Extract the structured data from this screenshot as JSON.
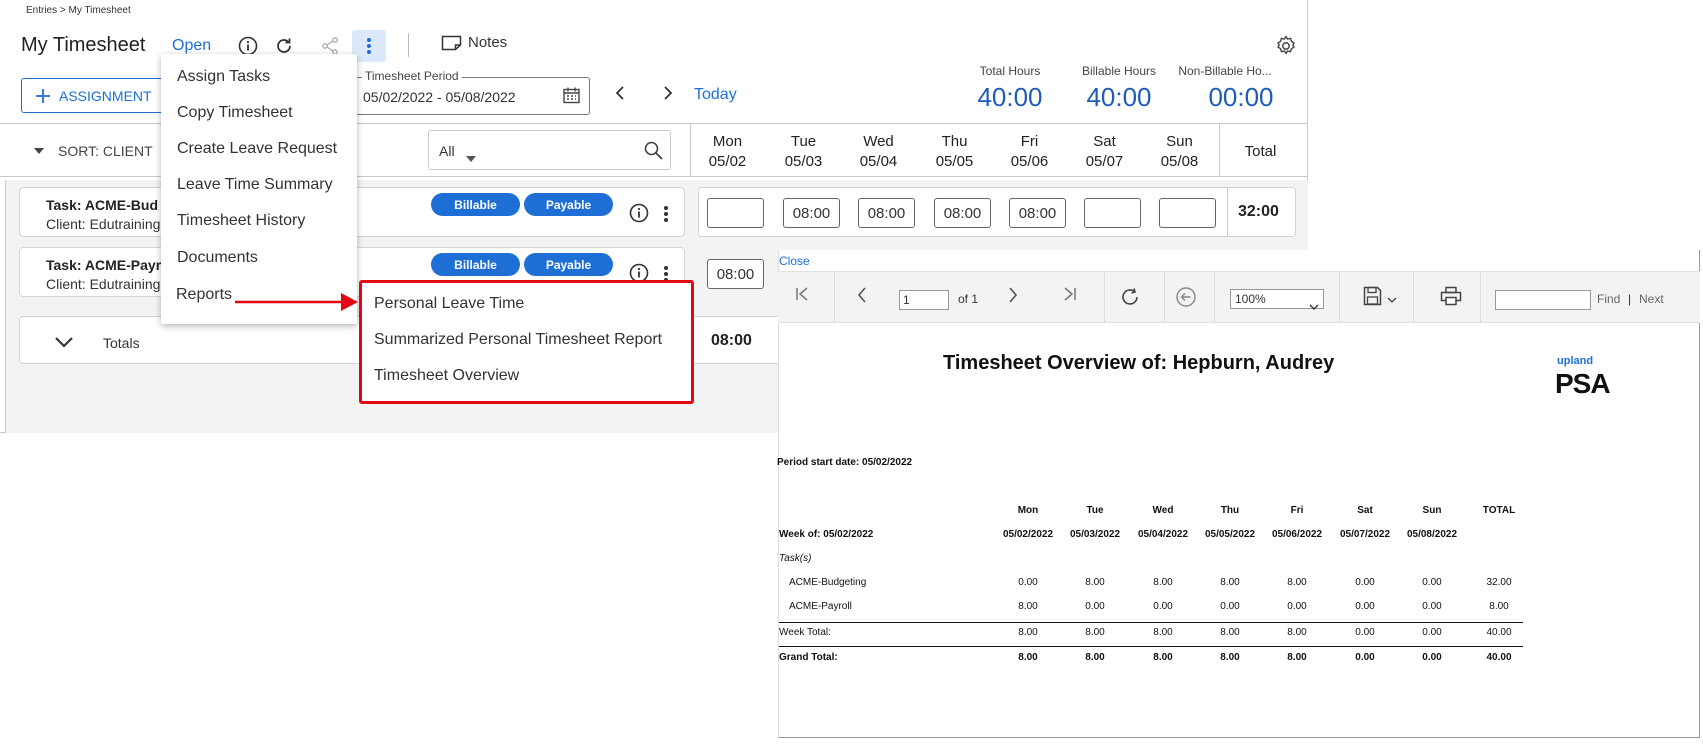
{
  "breadcrumb": "Entries > My Timesheet",
  "page_title": "My Timesheet",
  "status": "Open",
  "toolbar": {
    "notes_label": "Notes"
  },
  "assignment_button": "ASSIGNMENT",
  "period": {
    "label": "Timesheet Period",
    "value": "05/02/2022 - 05/08/2022",
    "today": "Today"
  },
  "summary": {
    "total_label": "Total Hours",
    "total_value": "40:00",
    "billable_label": "Billable Hours",
    "billable_value": "40:00",
    "nonbillable_label": "Non-Billable Ho...",
    "nonbillable_value": "00:00"
  },
  "sort_label": "SORT: CLIENT",
  "filter_value": "All",
  "days": [
    {
      "name": "Mon",
      "date": "05/02"
    },
    {
      "name": "Tue",
      "date": "05/03"
    },
    {
      "name": "Wed",
      "date": "05/04"
    },
    {
      "name": "Thu",
      "date": "05/05"
    },
    {
      "name": "Fri",
      "date": "05/06"
    },
    {
      "name": "Sat",
      "date": "05/07"
    },
    {
      "name": "Sun",
      "date": "05/08"
    }
  ],
  "total_header": "Total",
  "rows": [
    {
      "task": "Task: ACME-Bud",
      "client": "Client: Edutraining",
      "badges": [
        "Billable",
        "Payable"
      ],
      "hours": [
        "",
        "08:00",
        "08:00",
        "08:00",
        "08:00",
        "",
        ""
      ],
      "total": "32:00"
    },
    {
      "task": "Task: ACME-Payr",
      "client": "Client: Edutraining",
      "badges": [
        "Billable",
        "Payable"
      ],
      "hours": [
        "08:00"
      ]
    }
  ],
  "totals": {
    "label": "Totals",
    "mon": "08:00"
  },
  "menu": {
    "items": [
      "Assign Tasks",
      "Copy Timesheet",
      "Create Leave Request",
      "Leave Time Summary",
      "Timesheet History",
      "Documents",
      "Reports"
    ],
    "reports_submenu": [
      "Personal Leave Time",
      "Summarized Personal Timesheet Report",
      "Timesheet Overview"
    ]
  },
  "viewer": {
    "close": "Close",
    "page": "1",
    "of": "of 1",
    "zoom": "100%",
    "find": "Find",
    "next": "Next"
  },
  "report": {
    "title": "Timesheet Overview of:  Hepburn, Audrey",
    "logo_small": "upland",
    "logo_big": "PSA",
    "period_start": "Period start date: 05/02/2022",
    "day_headers": [
      "Mon",
      "Tue",
      "Wed",
      "Thu",
      "Fri",
      "Sat",
      "Sun",
      "TOTAL"
    ],
    "week_label": "Week of: 05/02/2022",
    "dates": [
      "05/02/2022",
      "05/03/2022",
      "05/04/2022",
      "05/05/2022",
      "05/06/2022",
      "05/07/2022",
      "05/08/2022"
    ],
    "tasks_label": "Task(s)",
    "lines": [
      {
        "name": "ACME-Budgeting",
        "values": [
          "0.00",
          "8.00",
          "8.00",
          "8.00",
          "8.00",
          "0.00",
          "0.00",
          "32.00"
        ]
      },
      {
        "name": "ACME-Payroll",
        "values": [
          "8.00",
          "0.00",
          "0.00",
          "0.00",
          "0.00",
          "0.00",
          "0.00",
          "8.00"
        ]
      }
    ],
    "week_total": {
      "label": "Week Total:",
      "values": [
        "8.00",
        "8.00",
        "8.00",
        "8.00",
        "8.00",
        "0.00",
        "0.00",
        "40.00"
      ]
    },
    "grand_total": {
      "label": "Grand Total:",
      "values": [
        "8.00",
        "8.00",
        "8.00",
        "8.00",
        "8.00",
        "0.00",
        "0.00",
        "40.00"
      ]
    }
  },
  "colors": {
    "accent": "#1d6fd6",
    "highlight": "#e30613"
  }
}
